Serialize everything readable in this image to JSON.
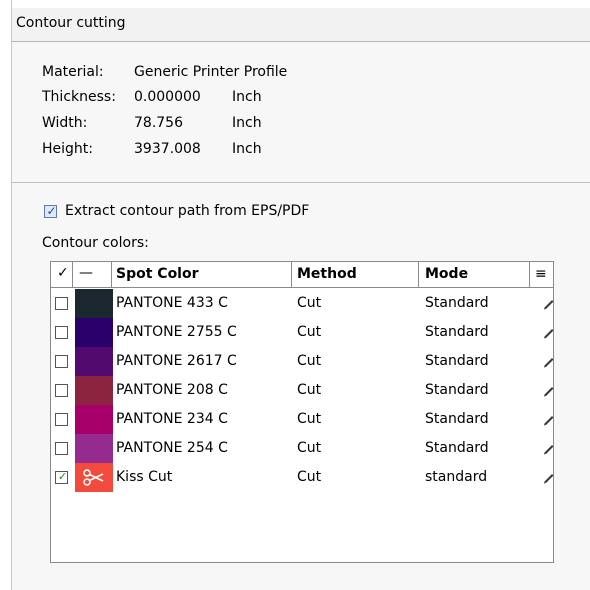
{
  "section_title": "Contour cutting",
  "info": {
    "material_label": "Material:",
    "material_value": "Generic Printer Profile",
    "thickness_label": "Thickness:",
    "thickness_value": "0.000000",
    "thickness_unit": "Inch",
    "width_label": "Width:",
    "width_value": "78.756",
    "width_unit": "Inch",
    "height_label": "Height:",
    "height_value": "3937.008",
    "height_unit": "Inch"
  },
  "extract_checkbox": {
    "label": "Extract contour path from EPS/PDF",
    "checked": true
  },
  "contour_colors_label": "Contour colors:",
  "table": {
    "headers": {
      "check": "✓",
      "swatch": "—",
      "spot_color": "Spot Color",
      "method": "Method",
      "mode": "Mode",
      "menu": "≡"
    },
    "rows": [
      {
        "checked": false,
        "color": "#1c2830",
        "name": "PANTONE 433 C",
        "method": "Cut",
        "mode": "Standard",
        "icon": ""
      },
      {
        "checked": false,
        "color": "#2a006b",
        "name": "PANTONE 2755 C",
        "method": "Cut",
        "mode": "Standard",
        "icon": ""
      },
      {
        "checked": false,
        "color": "#530a6f",
        "name": "PANTONE 2617 C",
        "method": "Cut",
        "mode": "Standard",
        "icon": ""
      },
      {
        "checked": false,
        "color": "#8c2440",
        "name": "PANTONE 208 C",
        "method": "Cut",
        "mode": "Standard",
        "icon": ""
      },
      {
        "checked": false,
        "color": "#a8006b",
        "name": "PANTONE 234 C",
        "method": "Cut",
        "mode": "Standard",
        "icon": ""
      },
      {
        "checked": false,
        "color": "#952a8f",
        "name": "PANTONE 254 C",
        "method": "Cut",
        "mode": "Standard",
        "icon": ""
      },
      {
        "checked": true,
        "color": "#f24a3c",
        "name": "Kiss Cut",
        "method": "Cut",
        "mode": "standard",
        "icon": "scissors-icon"
      }
    ]
  }
}
